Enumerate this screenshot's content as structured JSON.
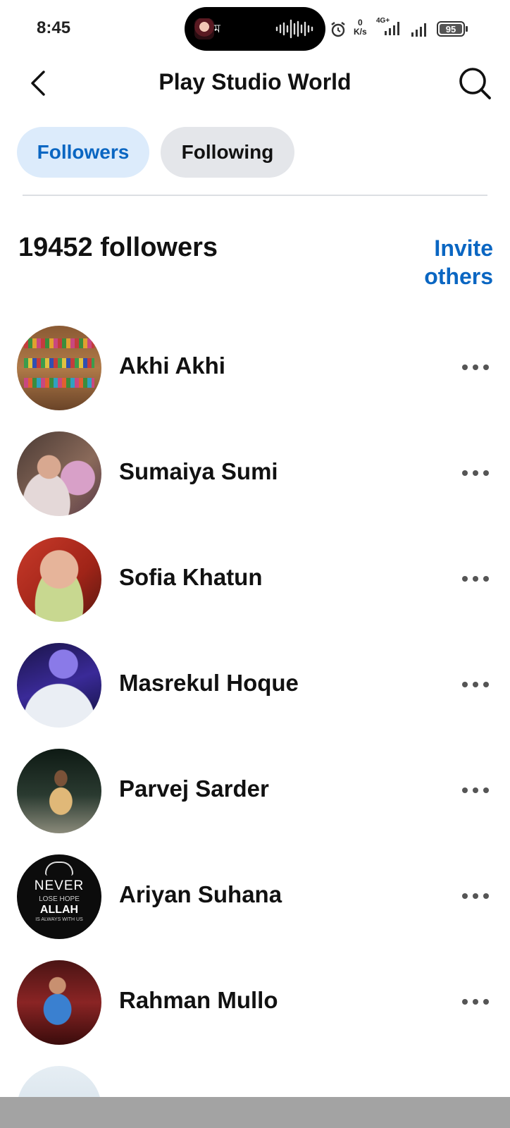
{
  "status_bar": {
    "time": "8:45",
    "island_letter": "ম",
    "speed_value": "0",
    "speed_unit": "K/s",
    "network": "4G+",
    "battery": "95"
  },
  "header": {
    "title": "Play Studio World"
  },
  "tabs": [
    {
      "label": "Followers",
      "active": true
    },
    {
      "label": "Following",
      "active": false
    }
  ],
  "followers": {
    "count_text": "19452 followers",
    "invite_line1": "Invite",
    "invite_line2": "others"
  },
  "list": [
    {
      "name": "Akhi Akhi"
    },
    {
      "name": "Sumaiya Sumi"
    },
    {
      "name": "Sofia Khatun"
    },
    {
      "name": "Masrekul Hoque"
    },
    {
      "name": "Parvej Sarder"
    },
    {
      "name": "Ariyan Suhana"
    },
    {
      "name": "Rahman Mullo"
    }
  ],
  "avatar_6_text": {
    "line1": "NEVER",
    "line2": "LOSE HOPE",
    "line3": "ALLAH",
    "line4": "IS ALWAYS WITH US"
  },
  "colors": {
    "accent": "#0a66c2",
    "active_tab_bg": "#dcebfb",
    "inactive_tab_bg": "#e4e6ea"
  }
}
